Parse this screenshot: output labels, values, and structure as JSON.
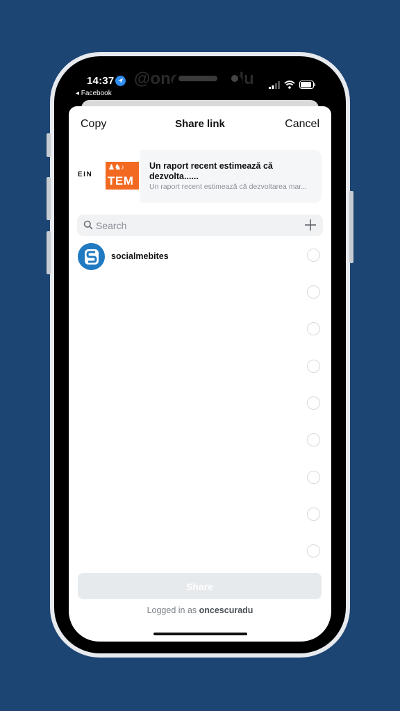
{
  "status_bar": {
    "time": "14:37",
    "location_icon": "location-arrow-icon",
    "back_app": "◂ Facebook",
    "watermark": "@oncescuradu",
    "icons": [
      "signal-icon",
      "wifi-icon",
      "battery-icon"
    ]
  },
  "header": {
    "left_button": "Copy",
    "title": "Share link",
    "right_button": "Cancel"
  },
  "preview": {
    "source_label": "EIN",
    "thumbnail_text_top": "♟♞♪",
    "thumbnail_text": "TEM",
    "title": "Un raport recent estimează că dezvolta......",
    "subtitle": "Un raport recent estimează că dezvoltarea mar..."
  },
  "search": {
    "placeholder": "Search",
    "value": "",
    "add_icon": "plus-icon"
  },
  "contacts": [
    {
      "name": "socialmebites",
      "avatar_letter": "S",
      "avatar_color": "#1f7ac2",
      "selected": false
    },
    {
      "name": "",
      "selected": false
    },
    {
      "name": "",
      "selected": false
    },
    {
      "name": "",
      "selected": false
    },
    {
      "name": "",
      "selected": false
    },
    {
      "name": "",
      "selected": false
    },
    {
      "name": "",
      "selected": false
    },
    {
      "name": "",
      "selected": false
    },
    {
      "name": "",
      "selected": false
    }
  ],
  "footer": {
    "share_label": "Share",
    "logged_in_prefix": "Logged in as ",
    "username": "oncescuradu"
  },
  "colors": {
    "background": "#1d4573",
    "thumbnail": "#f26a21",
    "share_disabled": "#e7eaed"
  }
}
